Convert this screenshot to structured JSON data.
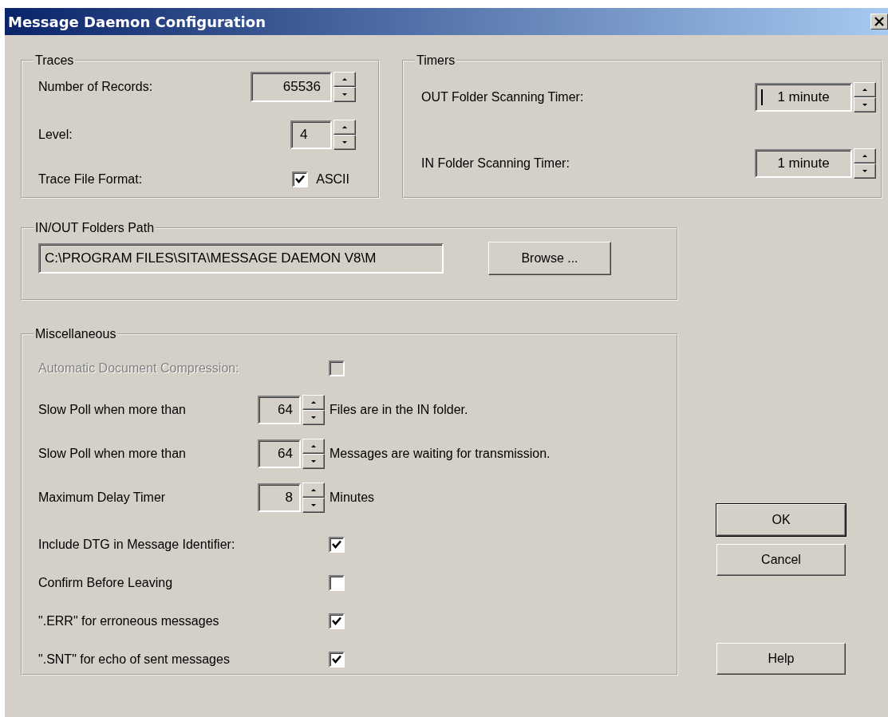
{
  "window": {
    "title": "Message Daemon Configuration"
  },
  "traces": {
    "title": "Traces",
    "number_of_records": {
      "label": "Number of Records:",
      "value": "65536"
    },
    "level": {
      "label": "Level:",
      "value": "4"
    },
    "trace_file_format": {
      "label": "Trace File Format:",
      "checkbox_label": "ASCII",
      "checked": true
    }
  },
  "timers": {
    "title": "Timers",
    "rows": [
      {
        "label": "OUT Folder Scanning Timer:",
        "value": "1 minute",
        "focused": true
      },
      {
        "label": "IN Folder Scanning Timer:",
        "value": "1 minute",
        "focused": false
      }
    ]
  },
  "folders": {
    "title": "IN/OUT Folders Path",
    "path": "C:\\PROGRAM FILES\\SITA\\MESSAGE DAEMON V8\\M",
    "browse": "Browse ..."
  },
  "misc": {
    "title": "Miscellaneous",
    "items": [
      {
        "kind": "checkbox",
        "label": "Automatic Document Compression:",
        "checked": false,
        "disabled": true
      },
      {
        "kind": "spinner",
        "label": "Slow Poll when more than",
        "value": "64",
        "suffix": "Files are in the IN folder."
      },
      {
        "kind": "spinner",
        "label": "Slow Poll when more than",
        "value": "64",
        "suffix": "Messages are waiting for transmission."
      },
      {
        "kind": "spinner",
        "label": "Maximum Delay Timer",
        "value": "8",
        "suffix": "Minutes"
      },
      {
        "kind": "checkbox",
        "label": "Include DTG in Message Identifier:",
        "checked": true,
        "disabled": false
      },
      {
        "kind": "checkbox",
        "label": "Confirm Before Leaving",
        "checked": false,
        "disabled": false
      },
      {
        "kind": "checkbox",
        "label": "\".ERR\" for erroneous messages",
        "checked": true,
        "disabled": false
      },
      {
        "kind": "checkbox",
        "label": "\".SNT\" for echo of sent messages",
        "checked": true,
        "disabled": false
      }
    ]
  },
  "buttons": [
    {
      "label": "OK",
      "default": true
    },
    {
      "label": "Cancel",
      "default": false
    },
    {
      "label": "Help",
      "default": false
    }
  ]
}
